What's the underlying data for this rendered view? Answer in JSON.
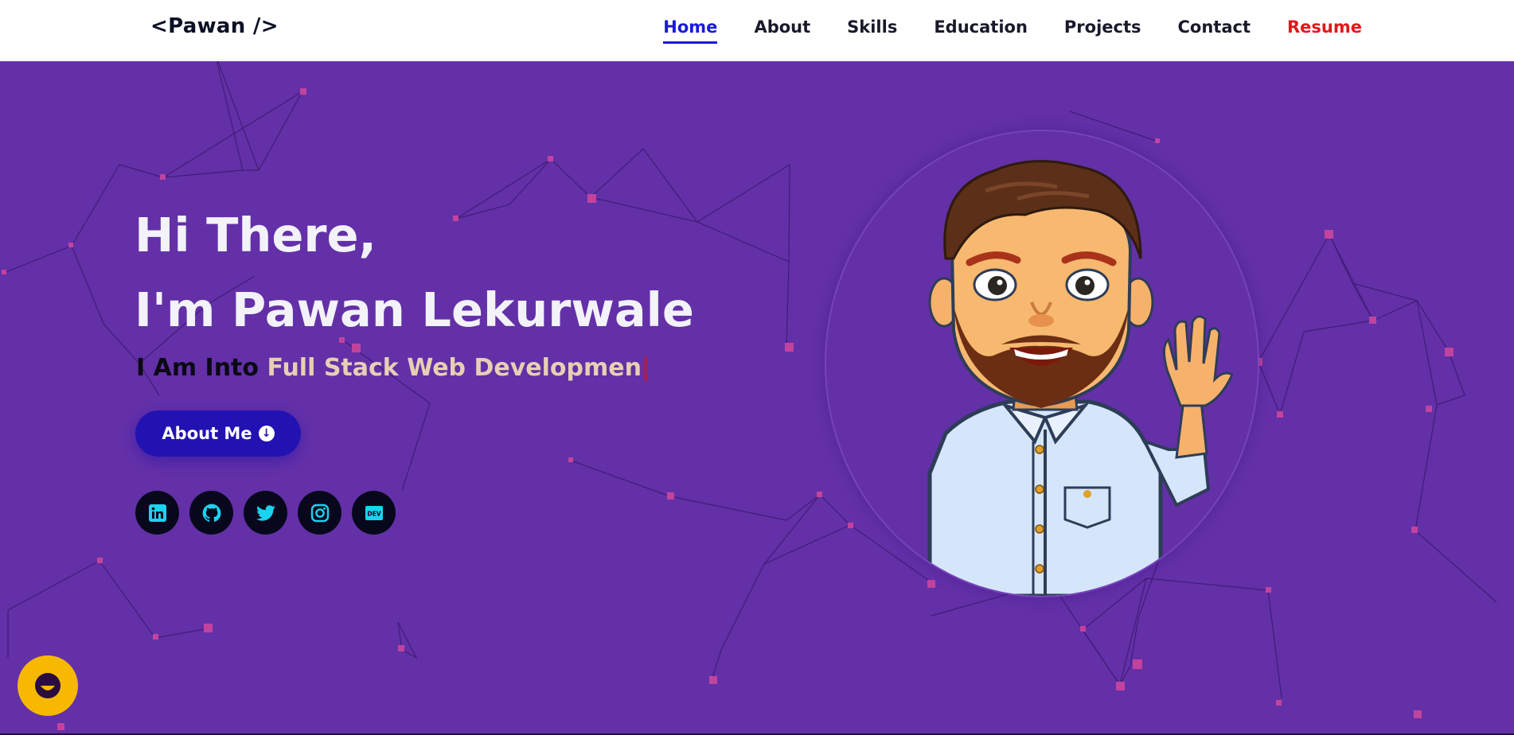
{
  "brand": {
    "logo_text": "<Pawan />"
  },
  "nav": {
    "items": [
      {
        "label": "Home",
        "active": true
      },
      {
        "label": "About"
      },
      {
        "label": "Skills"
      },
      {
        "label": "Education"
      },
      {
        "label": "Projects"
      },
      {
        "label": "Contact"
      },
      {
        "label": "Resume",
        "color": "#e4161a"
      }
    ]
  },
  "hero": {
    "greeting_line1": "Hi There,",
    "greeting_line2": "I'm Pawan Lekurwale",
    "tagline_prefix": "I Am Into ",
    "tagline_typed": "Full Stack Web Developmen",
    "typing_cursor": "|",
    "about_button_label": "About Me",
    "about_button_icon": "arrow-down-circle-icon"
  },
  "socials": [
    {
      "name": "linkedin",
      "icon": "linkedin-icon"
    },
    {
      "name": "github",
      "icon": "github-icon"
    },
    {
      "name": "twitter",
      "icon": "twitter-icon"
    },
    {
      "name": "instagram",
      "icon": "instagram-icon"
    },
    {
      "name": "dev",
      "icon": "dev-icon",
      "icon_text": "DEV"
    }
  ],
  "chat_widget": {
    "icon": "chat-bubble-icon"
  },
  "colors": {
    "hero_bg": "#6330a8",
    "accent": "#1a1ad6",
    "button_bg": "#2212b2",
    "social_icon": "#19d3f0",
    "resume": "#e4161a",
    "chat_widget": "#f7b801"
  }
}
